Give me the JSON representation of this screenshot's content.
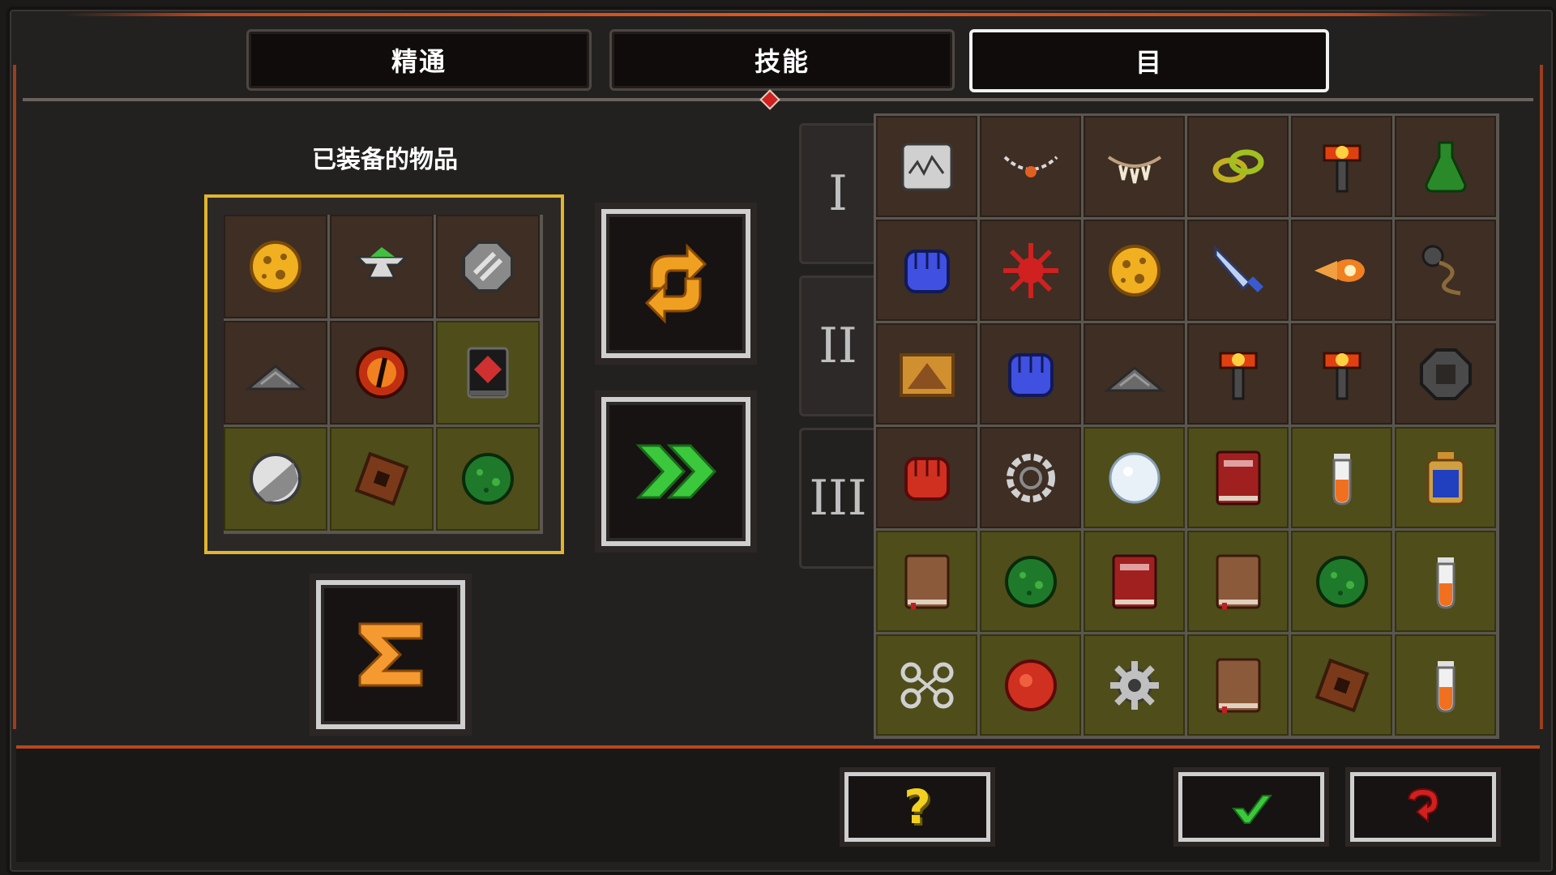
{
  "tabs": [
    {
      "label": "精通",
      "active": false
    },
    {
      "label": "技能",
      "active": false
    },
    {
      "label": "目",
      "active": true
    }
  ],
  "equipped": {
    "title": "已装备的物品",
    "items": [
      {
        "icon": "cheese-wheel-icon",
        "bg": "brown"
      },
      {
        "icon": "anvil-icon",
        "bg": "brown"
      },
      {
        "icon": "steel-disc-icon",
        "bg": "brown"
      },
      {
        "icon": "ash-pile-icon",
        "bg": "brown"
      },
      {
        "icon": "fire-eye-orb-icon",
        "bg": "brown"
      },
      {
        "icon": "dark-tome-icon",
        "bg": "olive"
      },
      {
        "icon": "moon-orb-icon",
        "bg": "olive"
      },
      {
        "icon": "rune-tile-icon",
        "bg": "olive"
      },
      {
        "icon": "moss-ball-icon",
        "bg": "olive"
      }
    ]
  },
  "actions": {
    "swap_icon": "swap-arrows-icon",
    "fast_forward_icon": "fast-forward-icon",
    "sum_icon": "sigma-icon",
    "sum_glyph": "Σ"
  },
  "inventory": {
    "pages": [
      "I",
      "II",
      "III"
    ],
    "items": [
      {
        "icon": "tablet-icon",
        "bg": "brown"
      },
      {
        "icon": "necklace-icon",
        "bg": "brown"
      },
      {
        "icon": "fang-necklace-icon",
        "bg": "brown"
      },
      {
        "icon": "chain-link-icon",
        "bg": "brown"
      },
      {
        "icon": "fire-hammer-icon",
        "bg": "brown"
      },
      {
        "icon": "green-flask-icon",
        "bg": "brown"
      },
      {
        "icon": "blue-fist-icon",
        "bg": "brown"
      },
      {
        "icon": "red-splat-icon",
        "bg": "brown"
      },
      {
        "icon": "cheese-wheel-icon",
        "bg": "brown"
      },
      {
        "icon": "dagger-icon",
        "bg": "brown"
      },
      {
        "icon": "fireball-icon",
        "bg": "brown"
      },
      {
        "icon": "flail-icon",
        "bg": "brown"
      },
      {
        "icon": "pyramid-card-icon",
        "bg": "brown"
      },
      {
        "icon": "blue-fist-icon",
        "bg": "brown"
      },
      {
        "icon": "ash-pile-icon",
        "bg": "brown"
      },
      {
        "icon": "fire-hammer-icon",
        "bg": "brown"
      },
      {
        "icon": "fire-hammer-icon",
        "bg": "brown"
      },
      {
        "icon": "iron-ring-icon",
        "bg": "brown"
      },
      {
        "icon": "red-fist-icon",
        "bg": "brown"
      },
      {
        "icon": "chain-ring-icon",
        "bg": "brown"
      },
      {
        "icon": "snow-orb-icon",
        "bg": "olive"
      },
      {
        "icon": "red-tome-icon",
        "bg": "olive"
      },
      {
        "icon": "vial-icon",
        "bg": "olive"
      },
      {
        "icon": "blue-potion-icon",
        "bg": "olive"
      },
      {
        "icon": "brown-book-icon",
        "bg": "olive"
      },
      {
        "icon": "moss-ball-icon",
        "bg": "olive"
      },
      {
        "icon": "red-tome-icon",
        "bg": "olive"
      },
      {
        "icon": "brown-book-icon",
        "bg": "olive"
      },
      {
        "icon": "moss-ball-icon",
        "bg": "olive"
      },
      {
        "icon": "vial-icon",
        "bg": "olive"
      },
      {
        "icon": "shackles-icon",
        "bg": "olive"
      },
      {
        "icon": "red-orb-icon",
        "bg": "olive"
      },
      {
        "icon": "cog-icon",
        "bg": "olive"
      },
      {
        "icon": "brown-book-icon",
        "bg": "olive"
      },
      {
        "icon": "rune-tile-icon",
        "bg": "olive"
      },
      {
        "icon": "vial-icon",
        "bg": "olive"
      }
    ]
  },
  "bottom": {
    "help_glyph": "?",
    "help_icon": "question-icon",
    "confirm_icon": "checkmark-icon",
    "back_icon": "return-arrow-icon"
  },
  "colors": {
    "accent_orange": "#e0561e",
    "equipped_border": "#e1b431",
    "confirm_green": "#3cc83c",
    "back_red": "#d02020",
    "help_yellow": "#f2d020"
  }
}
